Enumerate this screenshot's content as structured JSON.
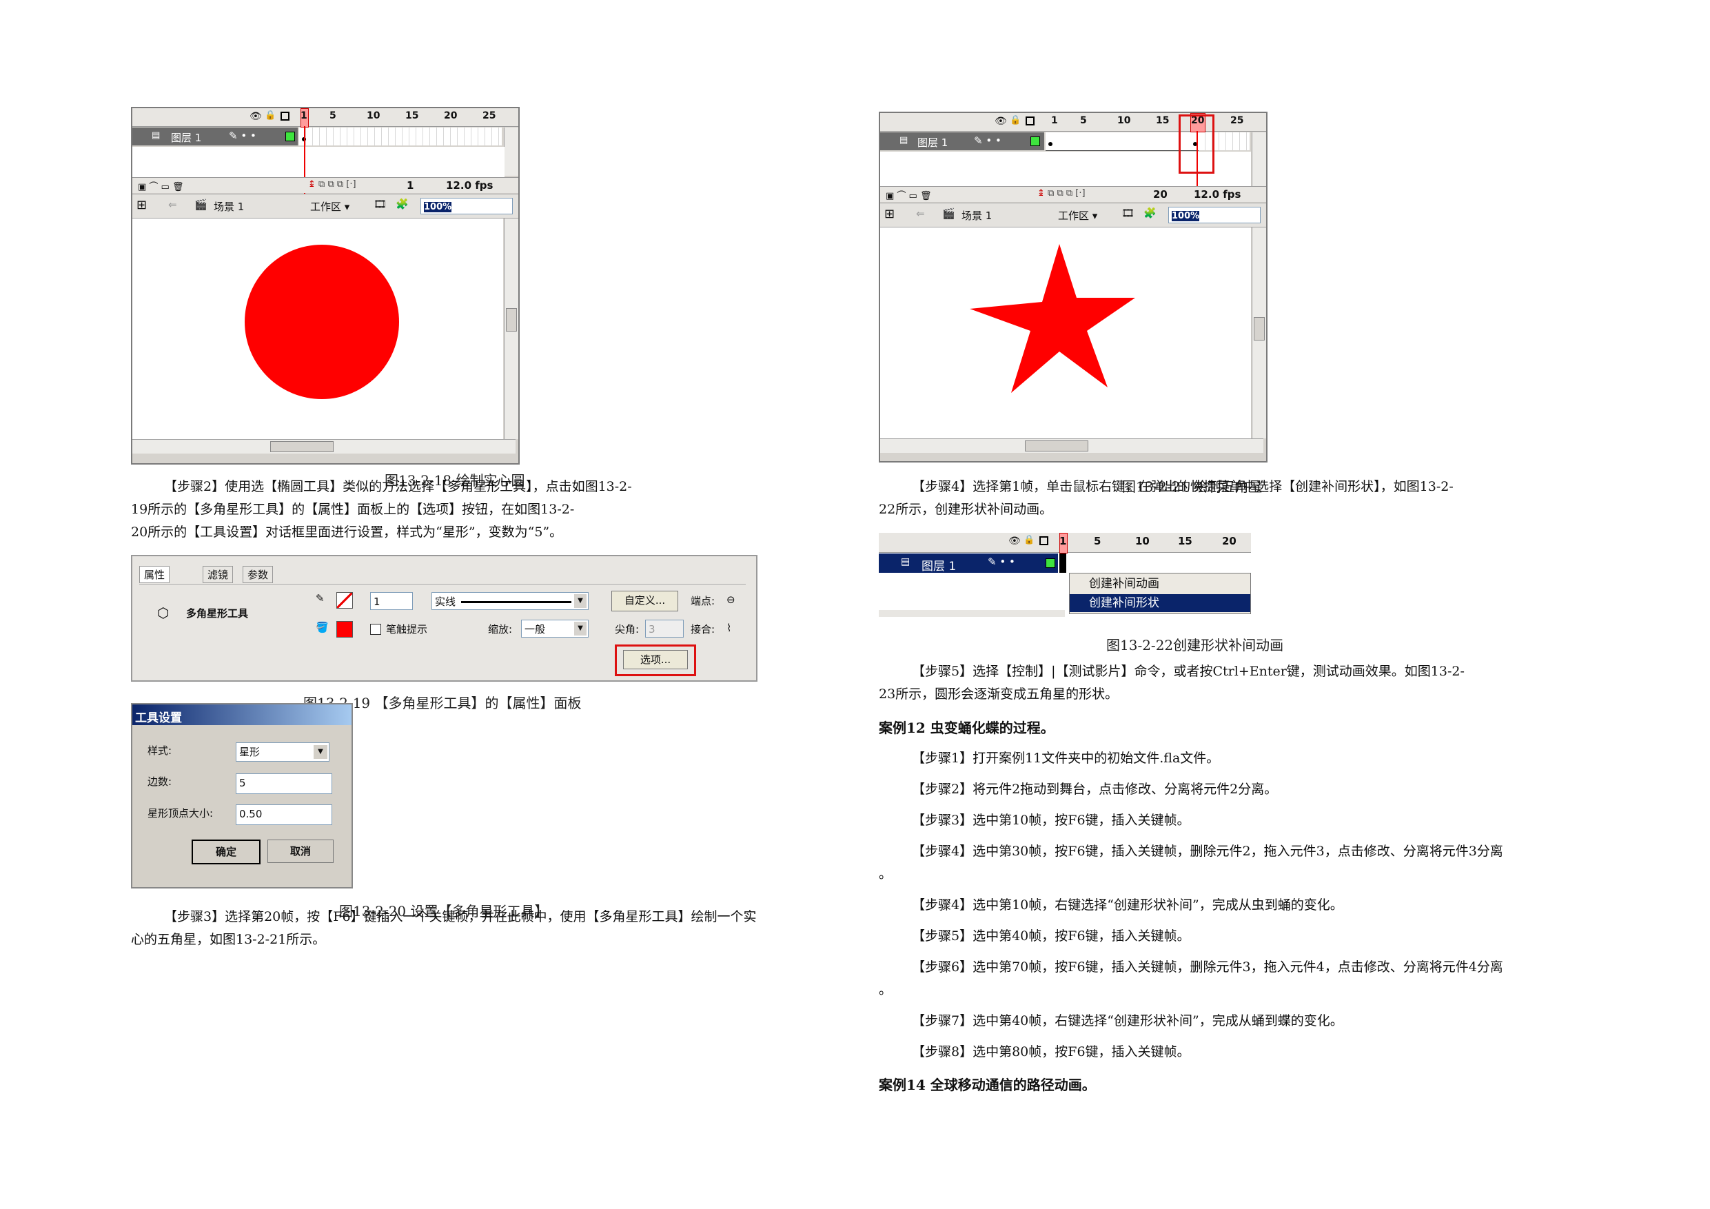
{
  "left": {
    "fig18": {
      "timeline": {
        "ruler": [
          "1",
          "5",
          "10",
          "15",
          "20",
          "25"
        ],
        "layer_name": "图层 1",
        "frame": "1",
        "fps": "12.0 fps"
      },
      "editbar": {
        "scene": "场景 1",
        "workspace": "工作区 ▾",
        "zoom": "100%"
      },
      "caption": "图13-2-18 绘制实心圆"
    },
    "step2_lines": [
      "【步骤2】使用选【椭圆工具】类似的方法选择【多角星形工具】，点击如图13-2-",
      "19所示的【多角星形工具】的【属性】面板上的【选项】按钮，在如图13-2-",
      "20所示的【工具设置】对话框里面进行设置，样式为“星形”，变数为“5”。"
    ],
    "fig19": {
      "tabs": [
        "属性",
        "滤镜",
        "参数"
      ],
      "tool_name": "多角星形工具",
      "stroke_width": "1",
      "stroke_style": "实线",
      "custom_btn": "自定义...",
      "cap_label": "端点:",
      "hint_label": "笔触提示",
      "scale_label": "缩放:",
      "scale_value": "一般",
      "miter_label": "尖角:",
      "miter_value": "3",
      "join_label": "接合:",
      "options_btn": "选项...",
      "caption": "图13-2-19 【多角星形工具】的【属性】面板"
    },
    "fig20": {
      "title": "工具设置",
      "style_label": "样式:",
      "style_value": "星形",
      "sides_label": "边数:",
      "sides_value": "5",
      "point_label": "星形顶点大小:",
      "point_value": "0.50",
      "ok": "确定",
      "cancel": "取消",
      "caption": "图13-2-20 设置【多角星形工具】"
    },
    "step3_lines": [
      "【步骤3】选择第20帧，按【F6】键插入一个关键帧，并在此帧中，使用【多角星形工具】绘制一个实",
      "心的五角星，如图13-2-21所示。"
    ]
  },
  "right": {
    "fig21": {
      "timeline": {
        "ruler": [
          "1",
          "5",
          "10",
          "15",
          "20",
          "25"
        ],
        "layer_name": "图层 1",
        "frame": "20",
        "fps": "12.0 fps"
      },
      "editbar": {
        "scene": "场景 1",
        "workspace": "工作区 ▾",
        "zoom": "100%"
      },
      "caption": "图13-2-21 绘制五角星"
    },
    "step4_lines": [
      "【步骤4】选择第1帧，单击鼠标右键，在弹出的快捷菜单中选择【创建补间形状】，如图13-2-",
      "22所示，创建形状补间动画。"
    ],
    "fig22": {
      "ruler": [
        "1",
        "5",
        "10",
        "15",
        "20"
      ],
      "layer_name": "图层 1",
      "menu": [
        "创建补间动画",
        "创建补间形状"
      ],
      "caption": "图13-2-22创建形状补间动画"
    },
    "step5_lines": [
      "【步骤5】选择【控制】|【测试影片】命令，或者按Ctrl+Enter键，测试动画效果。如图13-2-",
      "23所示，圆形会逐渐变成五角星的形状。"
    ],
    "case12": "案例12 虫变蛹化蝶的过程。",
    "case12_steps": [
      "【步骤1】打开案例11文件夹中的初始文件.fla文件。",
      "【步骤2】将元件2拖动到舞台，点击修改、分离将元件2分离。",
      "【步骤3】选中第10帧，按F6键，插入关键帧。",
      "【步骤4】选中第30帧，按F6键，插入关键帧，删除元件2，拖入元件3，点击修改、分离将元件3分离",
      "。",
      "【步骤4】选中第10帧，右键选择“创建形状补间”，完成从虫到蛹的变化。",
      "【步骤5】选中第40帧，按F6键，插入关键帧。",
      "【步骤6】选中第70帧，按F6键，插入关键帧，删除元件3，拖入元件4，点击修改、分离将元件4分离",
      "。",
      "【步骤7】选中第40帧，右键选择“创建形状补间”，完成从蛹到蝶的变化。",
      "【步骤8】选中第80帧，按F6键，插入关键帧。"
    ],
    "case14": "案例14 全球移动通信的路径动画。"
  },
  "colors": {
    "shape_red": "#ff0000",
    "highlight_box": "#d11111",
    "menu_selected": "#0a246a"
  }
}
